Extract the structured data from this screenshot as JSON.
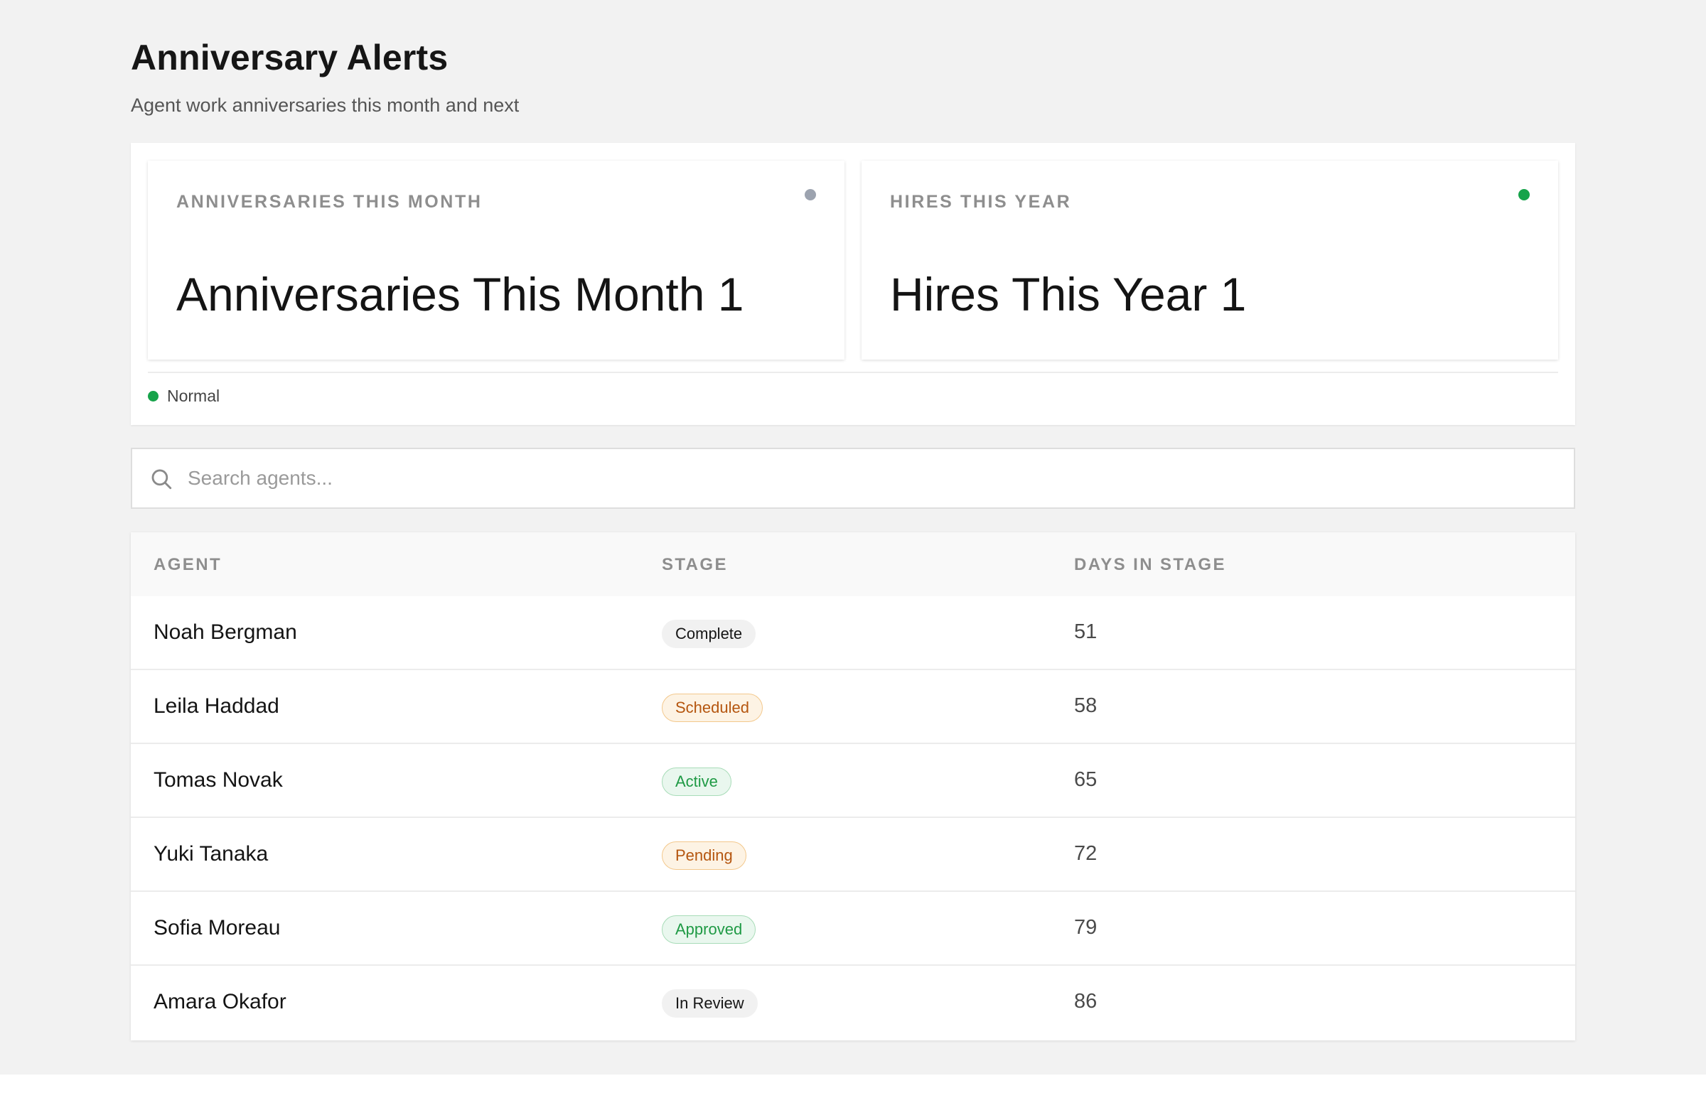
{
  "page": {
    "title": "Anniversary Alerts",
    "subtitle": "Agent work anniversaries this month and next"
  },
  "kpis": [
    {
      "label": "Anniversaries This Month",
      "value": "Anniversaries This Month 1",
      "indicator_color": "#9ca3af"
    },
    {
      "label": "Hires This Year",
      "value": "Hires This Year 1",
      "indicator_color": "#16a34a"
    }
  ],
  "status": {
    "text": "Normal",
    "color": "#16a34a"
  },
  "search": {
    "placeholder": "Search agents...",
    "value": "",
    "icon": "search-icon"
  },
  "table": {
    "columns": [
      "Agent",
      "Stage",
      "Days in Stage"
    ],
    "rows": [
      {
        "agent": "Noah Bergman",
        "stage": "Complete",
        "stage_tone": "neutral",
        "days": "51"
      },
      {
        "agent": "Leila Haddad",
        "stage": "Scheduled",
        "stage_tone": "warning",
        "days": "58"
      },
      {
        "agent": "Tomas Novak",
        "stage": "Active",
        "stage_tone": "success",
        "days": "65"
      },
      {
        "agent": "Yuki Tanaka",
        "stage": "Pending",
        "stage_tone": "warning",
        "days": "72"
      },
      {
        "agent": "Sofia Moreau",
        "stage": "Approved",
        "stage_tone": "success",
        "days": "79"
      },
      {
        "agent": "Amara Okafor",
        "stage": "In Review",
        "stage_tone": "neutral",
        "days": "86"
      }
    ]
  },
  "colors": {
    "page_background": "#f2f2f2",
    "badge_neutral": "#f1f1f1",
    "badge_warning_text": "#b5560f",
    "badge_success_text": "#1f9a45"
  }
}
